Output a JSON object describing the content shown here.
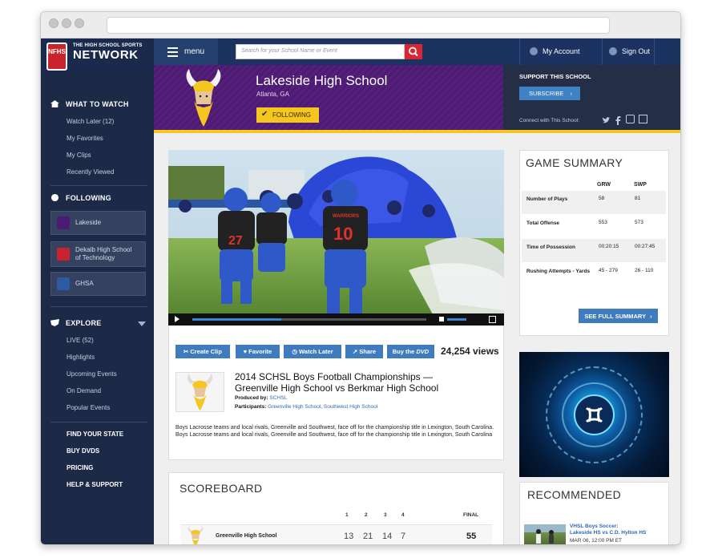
{
  "topnav": {
    "logo_small": "THE HIGH SCHOOL SPORTS",
    "logo_big": "NETWORK",
    "logo_badge": "NFHS",
    "menu_label": "menu",
    "search_placeholder": "Search for your School Name or Event",
    "account_label": "My Account",
    "signout_label": "Sign Out"
  },
  "sidebar": {
    "what_to_watch": "WHAT TO WATCH",
    "watch_links": [
      "Watch Later (12)",
      "My Favorites",
      "My Clips",
      "Recently Viewed"
    ],
    "following": "FOLLOWING",
    "following_items": [
      "Lakeside",
      "Dekalb High School",
      "of Technology",
      "GHSA"
    ],
    "explore": "EXPLORE",
    "explore_links": [
      "LIVE (52)",
      "Highlights",
      "Upcoming Events",
      "On Demand",
      "Popular Events"
    ],
    "bottom_links": [
      "FIND YOUR STATE",
      "BUY DVDS",
      "PRICING",
      "HELP & SUPPORT"
    ]
  },
  "school": {
    "name": "Lakeside High School",
    "location": "Atlanta, GA",
    "follow_label": "FOLLOWING",
    "support_title": "SUPPORT THIS SCHOOL",
    "subscribe_label": "SUBSCRIBE",
    "connect_label": "Connect with This School:"
  },
  "actions": {
    "create_clip": "Create Clip",
    "favorite": "Favorite",
    "watch_later": "Watch Later",
    "share": "Share",
    "buy_the": "Buy the",
    "dvd": "DVD",
    "views": "24,254 views"
  },
  "event": {
    "title": "2014 SCHSL Boys Football Championships — Greenville High School vs Berkmar High School",
    "produced_by_label": "Produced by:",
    "produced_by": "SCHSL",
    "participants_label": "Participants:",
    "participants": "Greenville High School, Southwest High School",
    "description": "Boys Lacrosse teams and local rivals, Greenville and Southwest, face off for the championship title in Lexington, South Carolina. Boys Lacrosse teams and local rivals, Greenville and Southwest, face off for the championship title in Lexington, South Carolina"
  },
  "game_summary": {
    "title": "GAME SUMMARY",
    "col_a": "GRW",
    "col_b": "SWP",
    "rows": [
      {
        "label": "Number of Plays",
        "a": "58",
        "b": "81"
      },
      {
        "label": "Total Offense",
        "a": "553",
        "b": "573"
      },
      {
        "label": "Time of Possession",
        "a": "00:20:15",
        "b": "00:27:45"
      },
      {
        "label": "Rushing Attempts - Yards",
        "a": "45 - 279",
        "b": "26 - 110"
      }
    ],
    "full_summary": "SEE FULL SUMMARY"
  },
  "scoreboard": {
    "title": "SCOREBOARD",
    "quarters": [
      "1",
      "2",
      "3",
      "4"
    ],
    "final_label": "FINAL",
    "team": "Greenville High School",
    "scores": [
      "13",
      "21",
      "14",
      "7"
    ],
    "final": "55"
  },
  "recommended": {
    "title": "RECOMMENDED",
    "item_title_1": "VHSL Boys Soccer:",
    "item_title_2": "Lakeside HS vs C.D. Hylton HS",
    "item_date": "MAR 06, 12:00 PM ET"
  },
  "video": {
    "jersey_a": "27",
    "jersey_b": "10",
    "team_text": "WARRIORS"
  },
  "colors": {
    "navy": "#1c3261",
    "purple": "#4c1b71",
    "gold": "#f4c61f",
    "action_blue": "#3e7bbf",
    "search_red": "#d82734"
  }
}
